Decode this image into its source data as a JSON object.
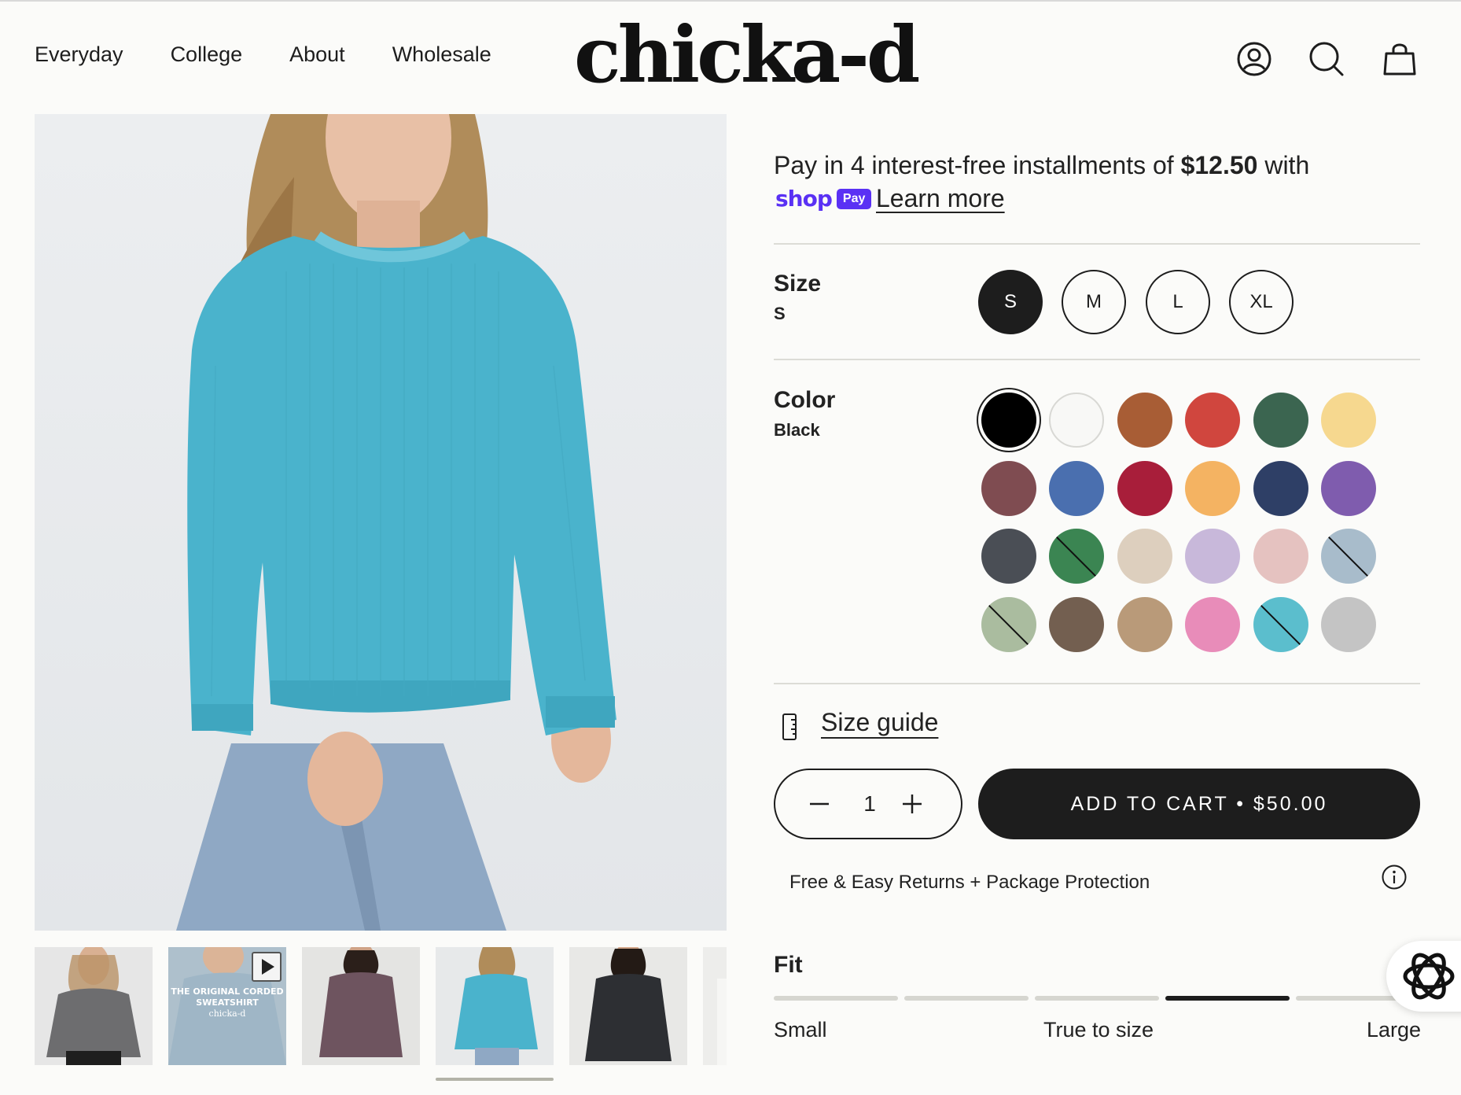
{
  "header": {
    "nav": [
      "Everyday",
      "College",
      "About",
      "Wholesale"
    ],
    "logo": "chicka-d",
    "icons": [
      "account-icon",
      "search-icon",
      "cart-icon"
    ]
  },
  "gallery": {
    "thumbnails": [
      {
        "name": "thumb-grey-sweatshirt"
      },
      {
        "name": "thumb-video",
        "caption_line1": "THE ORIGINAL CORDED",
        "caption_line2": "SWEATSHIRT",
        "caption_brand": "chicka-d"
      },
      {
        "name": "thumb-plum-sweatshirt"
      },
      {
        "name": "thumb-turquoise-sweatshirt"
      },
      {
        "name": "thumb-black-sweatshirt"
      }
    ]
  },
  "payment": {
    "prefix": "Pay in 4 interest-free installments of ",
    "amount": "$12.50",
    "suffix": " with",
    "shop_word": "shop",
    "pay_badge": "Pay",
    "learn_more": "Learn more"
  },
  "size": {
    "title": "Size",
    "selected": "S",
    "options": [
      "S",
      "M",
      "L",
      "XL"
    ]
  },
  "color": {
    "title": "Color",
    "selected": "Black",
    "swatches": [
      {
        "hex": "#000000",
        "sold_out": false
      },
      {
        "hex": "#f8f8f6",
        "sold_out": false
      },
      {
        "hex": "#a85d35",
        "sold_out": false
      },
      {
        "hex": "#d0463e",
        "sold_out": false
      },
      {
        "hex": "#3b6550",
        "sold_out": false
      },
      {
        "hex": "#f6d88f",
        "sold_out": false
      },
      {
        "hex": "#7f4c51",
        "sold_out": false
      },
      {
        "hex": "#4a6faf",
        "sold_out": false
      },
      {
        "hex": "#a81e3a",
        "sold_out": false
      },
      {
        "hex": "#f4b362",
        "sold_out": false
      },
      {
        "hex": "#2e3f66",
        "sold_out": false
      },
      {
        "hex": "#7f5cae",
        "sold_out": false
      },
      {
        "hex": "#4a4e55",
        "sold_out": false
      },
      {
        "hex": "#3b8552",
        "sold_out": true
      },
      {
        "hex": "#ddcfbe",
        "sold_out": false
      },
      {
        "hex": "#c8b8da",
        "sold_out": false
      },
      {
        "hex": "#e5c2c0",
        "sold_out": false
      },
      {
        "hex": "#a8bccb",
        "sold_out": true
      },
      {
        "hex": "#aabc9f",
        "sold_out": true
      },
      {
        "hex": "#735f50",
        "sold_out": false
      },
      {
        "hex": "#b99a79",
        "sold_out": false
      },
      {
        "hex": "#e88cb9",
        "sold_out": false
      },
      {
        "hex": "#5bbecd",
        "sold_out": true
      },
      {
        "hex": "#c4c4c4",
        "sold_out": false
      }
    ]
  },
  "size_guide": "Size guide",
  "quantity": {
    "value": "1"
  },
  "add_to_cart": "ADD TO CART • $50.00",
  "returns": "Free & Easy Returns + Package Protection",
  "fit": {
    "title": "Fit",
    "segments": 5,
    "active_segment": 4,
    "labels": {
      "left": "Small",
      "center": "True to size",
      "right": "Large"
    }
  },
  "colors": {
    "background": "#fbfbf9",
    "dark": "#1d1d1d",
    "shop_pay": "#5a31f4",
    "sweatshirt": "#4ab3cc"
  }
}
